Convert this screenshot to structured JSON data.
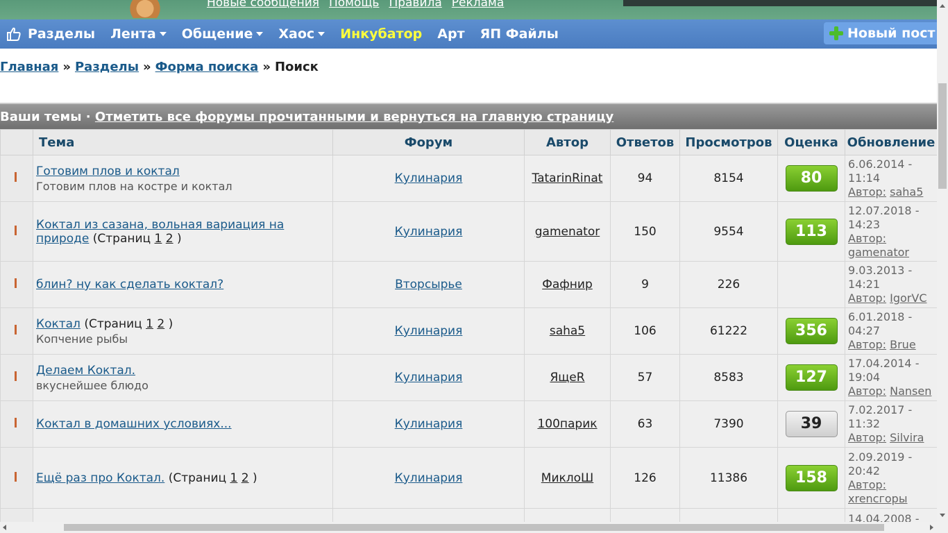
{
  "banner": {
    "links": [
      "Новые сообщения",
      "Помощь",
      "Правила",
      "Реклама"
    ]
  },
  "nav": {
    "items": [
      {
        "label": "Разделы",
        "dropdown": false,
        "highlight": false
      },
      {
        "label": "Лента",
        "dropdown": true,
        "highlight": false
      },
      {
        "label": "Общение",
        "dropdown": true,
        "highlight": false
      },
      {
        "label": "Хаос",
        "dropdown": true,
        "highlight": false
      },
      {
        "label": "Инкубатор",
        "dropdown": false,
        "highlight": true
      },
      {
        "label": "Арт",
        "dropdown": false,
        "highlight": false
      },
      {
        "label": "ЯП Файлы",
        "dropdown": false,
        "highlight": false
      }
    ],
    "new_post": "Новый пост"
  },
  "breadcrumb": {
    "home": "Главная",
    "sections": "Разделы",
    "search_form": "Форма поиска",
    "current": "Поиск",
    "sep": "»"
  },
  "headbar": {
    "prefix": "Ваши темы ·",
    "mark_read": "Отметить все форумы прочитанными и вернуться на главную страницу"
  },
  "table": {
    "headers": {
      "topic": "Тема",
      "forum": "Форум",
      "author": "Автор",
      "replies": "Ответов",
      "views": "Просмотров",
      "rating": "Оценка",
      "updated": "Обновление"
    },
    "pages_label": "(Страниц",
    "author_label": "Автор:",
    "rows": [
      {
        "title": "Готовим плов и коктал",
        "desc": "Готовим плов на костре и коктал",
        "pages": false,
        "forum": "Кулинария",
        "author": "TatarinRinat",
        "replies": "94",
        "views": "8154",
        "rating": "80",
        "rating_style": "green",
        "date": "6.06.2014 -",
        "time": "11:14",
        "last_author": "saha5"
      },
      {
        "title": "Коктал из сазана, вольная вариация на природе",
        "desc": "",
        "pages": true,
        "forum": "Кулинария",
        "author": "gamenator",
        "replies": "150",
        "views": "9554",
        "rating": "113",
        "rating_style": "green",
        "date": "12.07.2018 -",
        "time": "14:23",
        "last_author": "gamenator"
      },
      {
        "title": "блин? ну как сделать коктал?",
        "desc": "",
        "pages": false,
        "forum": "Вторсырье",
        "author": "Фафнир",
        "replies": "9",
        "views": "226",
        "rating": "",
        "rating_style": "none",
        "date": "9.03.2013 -",
        "time": "14:21",
        "last_author": "IgorVC"
      },
      {
        "title": "Коктал",
        "desc": "Копчение рыбы",
        "pages": true,
        "forum": "Кулинария",
        "author": "saha5",
        "replies": "106",
        "views": "61222",
        "rating": "356",
        "rating_style": "green",
        "date": "6.01.2018 -",
        "time": "04:27",
        "last_author": "Brue"
      },
      {
        "title": "Делаем Коктал.",
        "desc": "вкуснейшее блюдо",
        "pages": false,
        "forum": "Кулинария",
        "author": "ЯщеR",
        "replies": "57",
        "views": "8583",
        "rating": "127",
        "rating_style": "green",
        "date": "17.04.2014 -",
        "time": "19:04",
        "last_author": "Nansen"
      },
      {
        "title": "Коктал в домашних условиях...",
        "desc": "",
        "pages": false,
        "forum": "Кулинария",
        "author": "100парик",
        "replies": "63",
        "views": "7390",
        "rating": "39",
        "rating_style": "gray",
        "date": "7.02.2017 -",
        "time": "11:32",
        "last_author": "Silvira"
      },
      {
        "title": "Ещё раз про Коктал.",
        "desc": "",
        "pages": true,
        "forum": "Кулинария",
        "author": "МиклоШ",
        "replies": "126",
        "views": "11386",
        "rating": "158",
        "rating_style": "green",
        "date": "2.09.2019 -",
        "time": "20:42",
        "last_author": "хrencгоры"
      },
      {
        "title": "",
        "desc": "",
        "pages": false,
        "forum": "",
        "author": "",
        "replies": "",
        "views": "",
        "rating": "",
        "rating_style": "none",
        "date": "14.04.2008 -",
        "time": "",
        "last_author": ""
      }
    ]
  },
  "colors": {
    "navbar": "#5d8fd0",
    "highlight": "#ffff3c",
    "link": "#1a5a8a",
    "rating_green": "#6cb820"
  }
}
